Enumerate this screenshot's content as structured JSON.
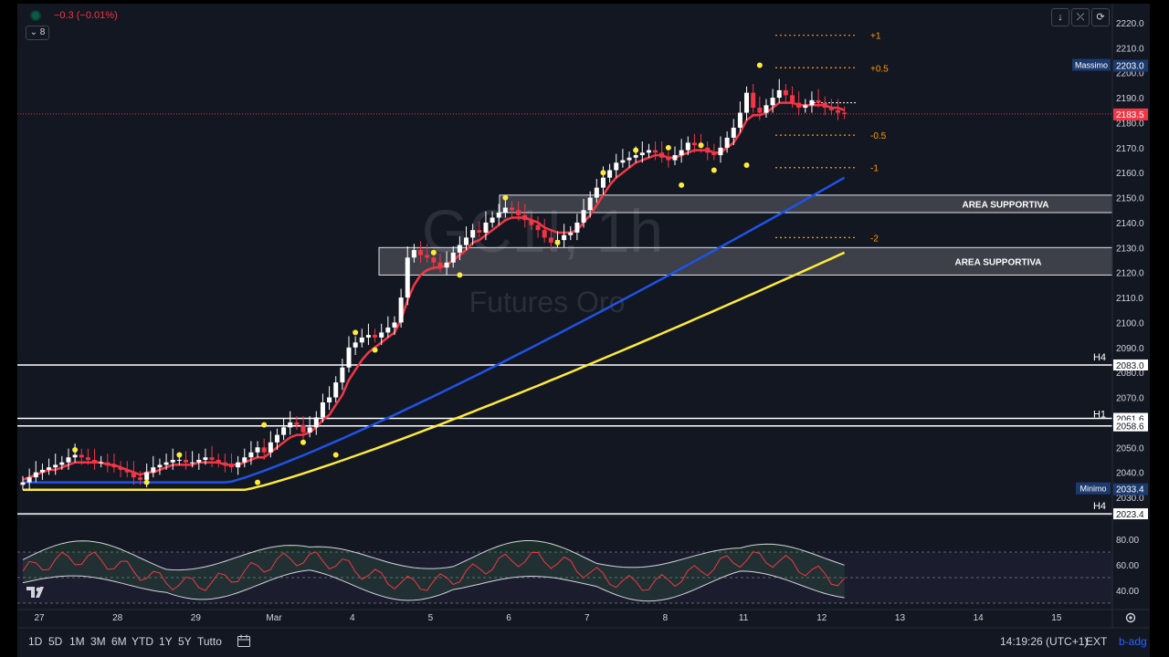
{
  "header": {
    "status_icon": "green-dot-icon",
    "change": "−0.3 (−0.01%)",
    "change_color": "#f23645",
    "indicator_count": "8",
    "top_buttons": [
      {
        "icon": "arrow-down-icon",
        "glyph": "↓"
      },
      {
        "icon": "collapse-icon",
        "glyph": "⤫"
      },
      {
        "icon": "refresh-icon",
        "glyph": "⟳"
      }
    ]
  },
  "watermark": {
    "symbol": "GC1!, 1h",
    "description": "Futures Oro"
  },
  "chart_data": {
    "type": "candlestick",
    "symbol": "GC1!",
    "interval": "1h",
    "ylim": [
      2020,
      2225
    ],
    "y_ticks": [
      "2220.0",
      "2210.0",
      "2200.0",
      "2190.0",
      "2180.0",
      "2170.0",
      "2160.0",
      "2150.0",
      "2140.0",
      "2130.0",
      "2120.0",
      "2110.0",
      "2100.0",
      "2090.0",
      "2080.0",
      "2070.0",
      "2060.0",
      "2050.0",
      "2040.0",
      "2030.0"
    ],
    "y_tick_values": [
      2220,
      2210,
      2200,
      2190,
      2180,
      2170,
      2160,
      2150,
      2140,
      2130,
      2120,
      2110,
      2100,
      2090,
      2080,
      2070,
      2060,
      2050,
      2040,
      2030
    ],
    "x_ticks": [
      "27",
      "28",
      "29",
      "Mar",
      "4",
      "5",
      "6",
      "7",
      "8",
      "11",
      "12",
      "13",
      "14",
      "15"
    ],
    "x_tick_index": [
      0,
      12,
      24,
      36,
      48,
      60,
      72,
      84,
      96,
      108,
      120,
      132,
      144,
      156
    ],
    "closes": [
      2036,
      2038,
      2040,
      2041,
      2042,
      2043,
      2044,
      2046,
      2047,
      2046,
      2045,
      2044,
      2044,
      2043,
      2042,
      2041,
      2040,
      2038,
      2037,
      2040,
      2042,
      2043,
      2044,
      2045,
      2045,
      2044,
      2044,
      2045,
      2046,
      2045,
      2044,
      2043,
      2042,
      2044,
      2046,
      2048,
      2050,
      2048,
      2052,
      2055,
      2058,
      2060,
      2059,
      2056,
      2058,
      2062,
      2068,
      2070,
      2076,
      2082,
      2090,
      2092,
      2094,
      2095,
      2094,
      2096,
      2098,
      2100,
      2110,
      2126,
      2129,
      2127,
      2126,
      2124,
      2122,
      2124,
      2128,
      2131,
      2134,
      2137,
      2136,
      2140,
      2142,
      2144,
      2146,
      2145,
      2143,
      2141,
      2139,
      2137,
      2134,
      2132,
      2133,
      2135,
      2136,
      2140,
      2145,
      2150,
      2154,
      2158,
      2161,
      2164,
      2165,
      2166,
      2167,
      2168,
      2169,
      2168,
      2166,
      2165,
      2167,
      2169,
      2172,
      2171,
      2170,
      2168,
      2167,
      2170,
      2174,
      2178,
      2184,
      2192,
      2186,
      2184,
      2187,
      2190,
      2193,
      2191,
      2188,
      2186,
      2187,
      2189,
      2188,
      2186,
      2185,
      2184,
      2183.5
    ],
    "ema_fast": {
      "color": "#f23645",
      "values": [
        2037,
        2038,
        2039,
        2040,
        2041,
        2041,
        2042,
        2043,
        2044,
        2044,
        2044,
        2044,
        2044,
        2043,
        2043,
        2042,
        2041,
        2040,
        2039,
        2040,
        2040,
        2041,
        2042,
        2043,
        2043,
        2043,
        2043,
        2044,
        2044,
        2044,
        2044,
        2043,
        2043,
        2043,
        2044,
        2045,
        2046,
        2046,
        2048,
        2050,
        2052,
        2054,
        2055,
        2055,
        2056,
        2058,
        2061,
        2063,
        2067,
        2071,
        2077,
        2081,
        2085,
        2088,
        2090,
        2092,
        2094,
        2096,
        2101,
        2109,
        2115,
        2119,
        2121,
        2122,
        2122,
        2123,
        2125,
        2127,
        2129,
        2132,
        2133,
        2135,
        2137,
        2139,
        2141,
        2142,
        2142,
        2142,
        2141,
        2140,
        2138,
        2137,
        2136,
        2136,
        2136,
        2137,
        2140,
        2143,
        2147,
        2151,
        2155,
        2158,
        2160,
        2162,
        2164,
        2165,
        2166,
        2167,
        2167,
        2166,
        2166,
        2167,
        2168,
        2169,
        2169,
        2169,
        2168,
        2168,
        2170,
        2172,
        2176,
        2181,
        2183,
        2183,
        2184,
        2186,
        2188,
        2188,
        2188,
        2187,
        2187,
        2187,
        2187,
        2187,
        2186,
        2186,
        2185
      ]
    },
    "ema_mid": {
      "color": "#1e53e5",
      "start": 2036,
      "end": 2158
    },
    "ema_slow": {
      "color": "#ffeb3b",
      "start": 2033,
      "end": 2128
    },
    "support_zones": [
      {
        "label": "AREA SUPPORTIVA",
        "low": 2144,
        "high": 2151
      },
      {
        "label": "AREA SUPPORTIVA",
        "low": 2119,
        "high": 2130
      }
    ],
    "horizontal_levels": [
      {
        "label": "H4",
        "value": 2083.0,
        "badge": "2083.0"
      },
      {
        "label": "H1",
        "value": 2061.6,
        "badge": "2061.6"
      },
      {
        "label": "",
        "value": 2058.6,
        "badge": "2058.6"
      },
      {
        "label": "H4",
        "value": 2023.4,
        "badge": "2023.4"
      }
    ],
    "fib_levels": [
      {
        "label": "+1",
        "value": 2215
      },
      {
        "label": "+0.5",
        "value": 2202
      },
      {
        "label": "-0.5",
        "value": 2175
      },
      {
        "label": "-1",
        "value": 2162
      },
      {
        "label": "-2",
        "value": 2134
      }
    ],
    "markers": {
      "high_label": "Massimo",
      "high_value": "2203.0",
      "low_label": "Minimo",
      "low_value": "2033.4",
      "last_price": "2183.5",
      "last_color": "#f23645"
    },
    "oscillator": {
      "y_ticks": [
        "80.00",
        "60.00",
        "40.00"
      ],
      "ylim": [
        25,
        95
      ],
      "band_upper": 70,
      "band_lower": 30
    }
  },
  "footer": {
    "ranges": [
      "1D",
      "5D",
      "1M",
      "3M",
      "6M",
      "YTD",
      "1Y",
      "5Y",
      "Tutto"
    ],
    "calendar_icon": "calendar-range-icon",
    "time": "14:19:26 (UTC+1)",
    "ext": "EXT",
    "scale_mode": "b-adg",
    "logo": "tv-logo-icon",
    "settings_icon": "gear-icon"
  }
}
